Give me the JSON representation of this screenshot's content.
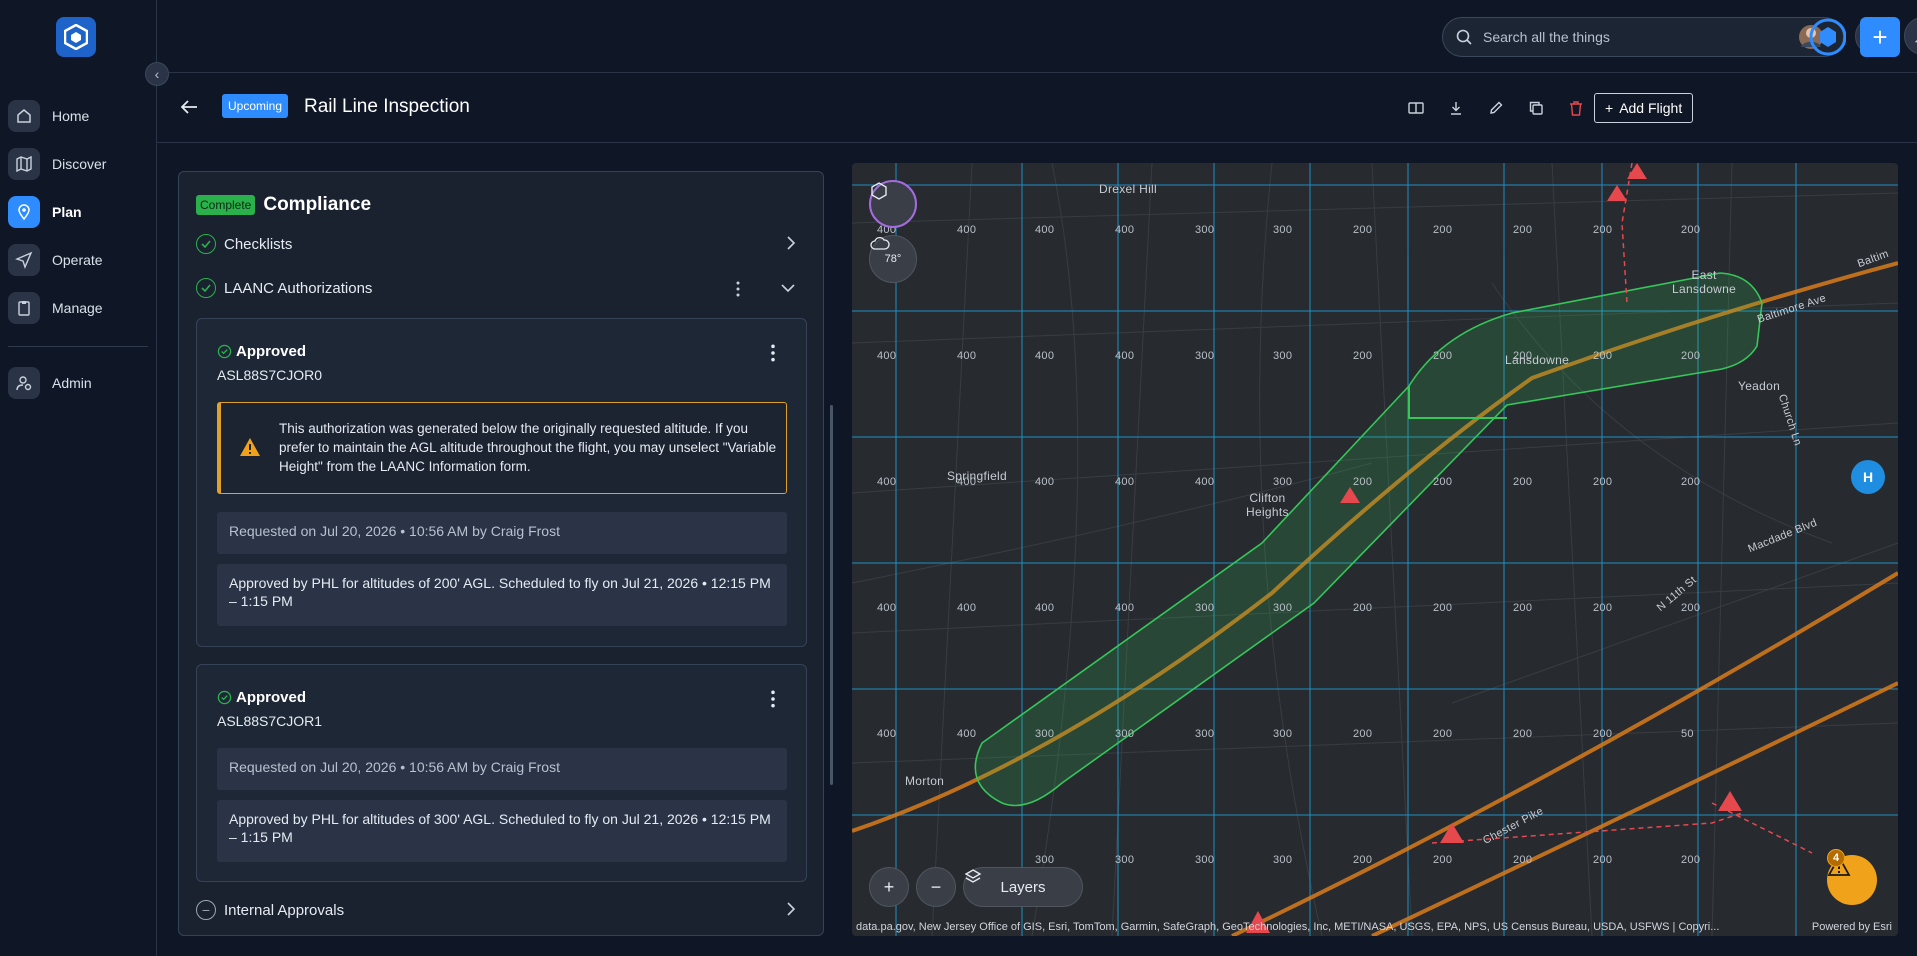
{
  "sidebar": {
    "items": [
      {
        "label": "Home",
        "icon": "home-icon"
      },
      {
        "label": "Discover",
        "icon": "map-icon"
      },
      {
        "label": "Plan",
        "icon": "location-pin-icon",
        "active": true
      },
      {
        "label": "Operate",
        "icon": "send-icon"
      },
      {
        "label": "Manage",
        "icon": "clipboard-icon"
      }
    ],
    "admin": {
      "label": "Admin",
      "icon": "user-settings-icon"
    }
  },
  "topbar": {
    "search_placeholder": "Search all the things"
  },
  "header": {
    "status_badge": "Upcoming",
    "title": "Rail Line Inspection",
    "add_flight_label": "Add Flight"
  },
  "compliance": {
    "status_badge": "Complete",
    "title": "Compliance",
    "checklists_label": "Checklists",
    "laanc_label": "LAANC Authorizations",
    "internal_label": "Internal Approvals",
    "authorizations": [
      {
        "status": "Approved",
        "id": "ASL88S7CJOR0",
        "warning": "This authorization was generated below the originally requested altitude. If you prefer to maintain the AGL altitude throughout the flight, you may unselect \"Variable Height\" from the LAANC Information form.",
        "requested": "Requested on Jul 20, 2026 • 10:56 AM by Craig Frost",
        "approval": "Approved by PHL for altitudes of 200' AGL. Scheduled to fly on Jul 21, 2026 • 12:15 PM – 1:15 PM"
      },
      {
        "status": "Approved",
        "id": "ASL88S7CJOR1",
        "requested": "Requested on Jul 20, 2026 • 10:56 AM by Craig Frost",
        "approval": "Approved by PHL for altitudes of 300' AGL. Scheduled to fly on Jul 21, 2026 • 12:15 PM – 1:15 PM"
      }
    ]
  },
  "map": {
    "weather_temp": "78°",
    "layers_label": "Layers",
    "alert_count": "4",
    "heliport_label": "H",
    "attribution": "data.pa.gov, New Jersey Office of GIS, Esri, TomTom, Garmin, SafeGraph, GeoTechnologies, Inc, METI/NASA, USGS, EPA, NPS, US Census Bureau, USDA, USFWS | Copyri...",
    "powered_by": "Powered by Esri",
    "places": {
      "drexel_hill": "Drexel Hill",
      "east_lansdowne": "East\nLansdowne",
      "lansdowne": "Lansdowne",
      "yeadon": "Yeadon",
      "springfield": "Springfield",
      "clifton_heights": "Clifton\nHeights",
      "morton": "Morton",
      "baltimore_ave": "Baltimore Ave",
      "church_ln": "Church Ln",
      "macdade_blvd": "Macdade Blvd",
      "n11th_st": "N 11th St",
      "chester_pike": "Chester Pike",
      "baltim": "Baltim"
    },
    "grid_rows": [
      [
        "400",
        "400",
        "400",
        "400",
        "300",
        "300",
        "200",
        "200",
        "200",
        "200",
        "200"
      ],
      [
        "400",
        "400",
        "400",
        "400",
        "300",
        "300",
        "200",
        "200",
        "200",
        "200",
        "200"
      ],
      [
        "400",
        "400",
        "400",
        "400",
        "400",
        "300",
        "200",
        "200",
        "200",
        "200",
        "200"
      ],
      [
        "400",
        "400",
        "400",
        "400",
        "300",
        "300",
        "200",
        "200",
        "200",
        "200",
        "200"
      ],
      [
        "400",
        "400",
        "300",
        "300",
        "300",
        "300",
        "200",
        "200",
        "200",
        "200",
        "50"
      ],
      [
        "",
        "",
        "300",
        "300",
        "300",
        "300",
        "200",
        "200",
        "200",
        "200",
        "200"
      ]
    ],
    "colors": {
      "grid": "#1e9ad6",
      "flight_area": "#35c759",
      "rail": "#d97b1a",
      "hazard": "#e5484d"
    }
  }
}
